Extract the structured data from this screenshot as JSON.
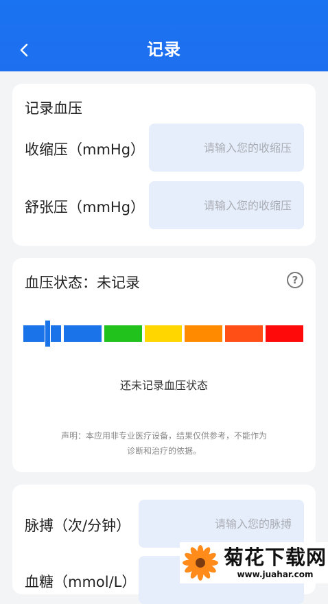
{
  "header": {
    "title": "记录",
    "back_icon": "chevron-left-icon"
  },
  "bp_card": {
    "title": "记录血压",
    "systolic": {
      "label": "收缩压（mmHg）",
      "placeholder": "请输入您的收缩压",
      "value": ""
    },
    "diastolic": {
      "label": "舒张压（mmHg）",
      "placeholder": "请输入您的收缩压",
      "value": ""
    }
  },
  "status_card": {
    "title": "血压状态：未记录",
    "help_icon": "question-circle-icon",
    "help_glyph": "?",
    "segment_colors": [
      "#1a73e8",
      "#1a73e8",
      "#22c21c",
      "#ffd600",
      "#ff8a00",
      "#ff4f17",
      "#ff0a0a"
    ],
    "empty_text": "还未记录血压状态",
    "disclaimer_line1": "声明：本应用非专业医疗设备，结果仅供参考，不能作为",
    "disclaimer_line2": "诊断和治疗的依据。"
  },
  "extra_card": {
    "pulse": {
      "label": "脉搏（次/分钟）",
      "placeholder": "请输入您的脉搏",
      "value": ""
    },
    "sugar": {
      "label": "血糖（mmol/L）",
      "value": ""
    }
  },
  "watermark": {
    "main": "菊花下载网",
    "sub": "www.juahar.com"
  }
}
